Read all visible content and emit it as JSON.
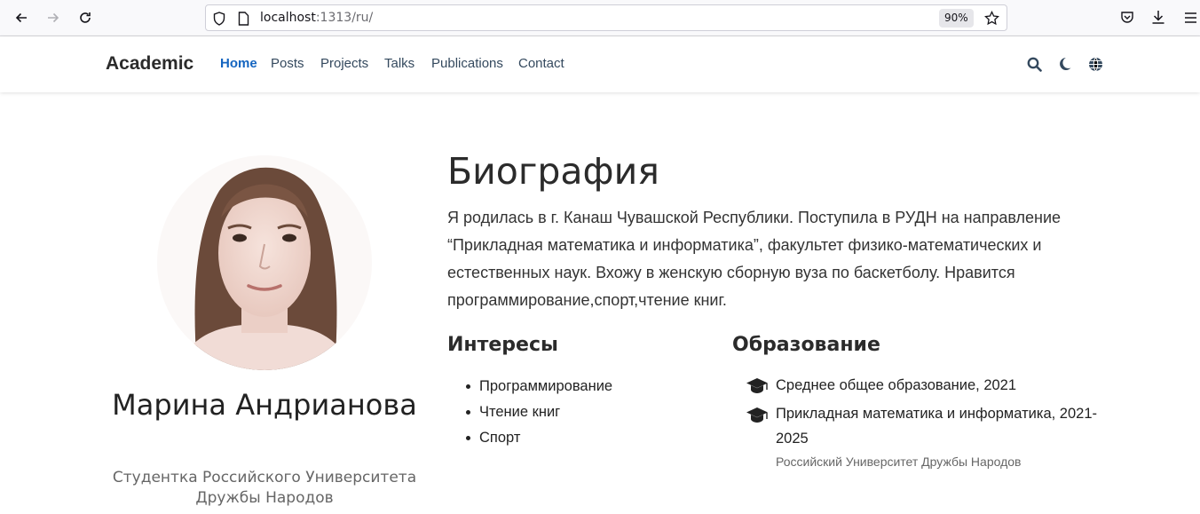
{
  "browser": {
    "url_host": "localhost",
    "url_rest": ":1313/ru/",
    "zoom": "90%"
  },
  "site": {
    "brand": "Academic",
    "menu": [
      {
        "label": "Home",
        "active": true
      },
      {
        "label": "Posts",
        "active": false
      },
      {
        "label": "Projects",
        "active": false
      },
      {
        "label": "Talks",
        "active": false
      },
      {
        "label": "Publications",
        "active": false
      },
      {
        "label": "Contact",
        "active": false
      }
    ],
    "icons": [
      "search-icon",
      "dark-mode-icon",
      "language-icon"
    ]
  },
  "profile": {
    "name": "Марина Андрианова",
    "role": "Студентка Российского Университета Дружбы Народов"
  },
  "biography": {
    "title": "Биография",
    "text": "Я родилась в г. Канаш Чувашской Республики. Поступила в РУДН на направление “Прикладная математика и информатика”, факультет физико-математических и естественных наук. Вхожу в женскую сборную вуза по баскетболу. Нравится программирование,спорт,чтение книг."
  },
  "interests": {
    "title": "Интересы",
    "items": [
      "Программирование",
      "Чтение книг",
      "Спорт"
    ]
  },
  "education": {
    "title": "Образование",
    "items": [
      {
        "course": "Среднее общее образование, 2021",
        "institution": ""
      },
      {
        "course": "Прикладная математика и информатика, 2021-2025",
        "institution": "Российский Университет Дружбы Народов"
      }
    ]
  },
  "colors": {
    "accent": "#1565c0",
    "text": "#222222",
    "muted": "#666666"
  }
}
